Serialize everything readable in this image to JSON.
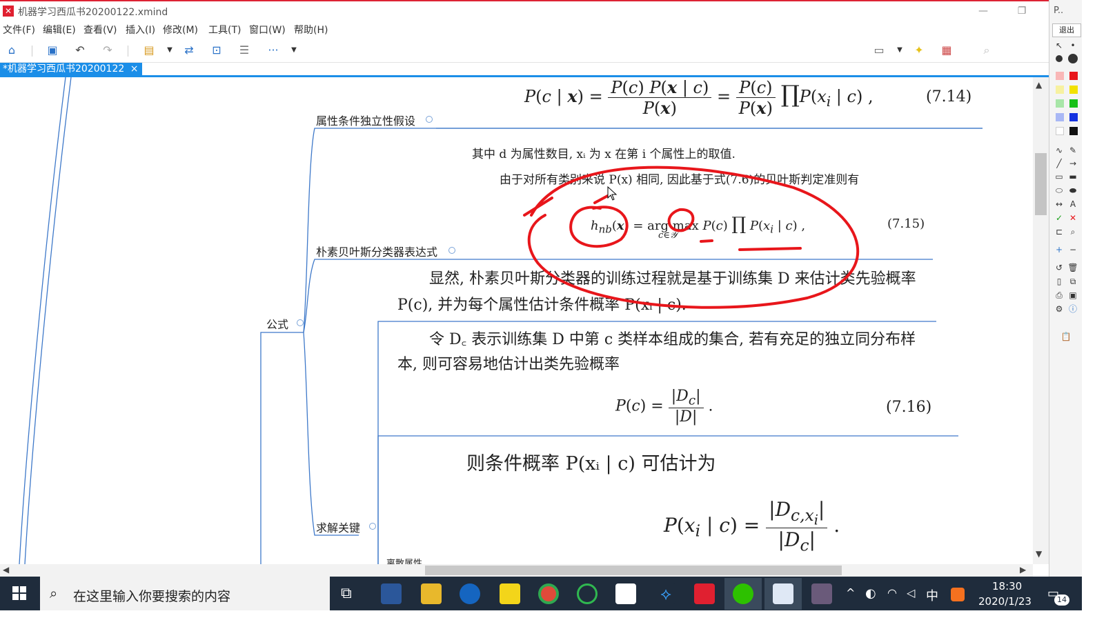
{
  "window": {
    "title": "机器学习西瓜书20200122.xmind",
    "logo_glyph": "✕"
  },
  "menu": [
    "文件(F)",
    "编辑(E)",
    "查看(V)",
    "插入(I)",
    "修改(M)",
    "工具(T)",
    "窗口(W)",
    "帮助(H)"
  ],
  "tab": {
    "label": "*机器学习西瓜书20200122",
    "close": "×"
  },
  "topics": {
    "t1": "属性条件独立性假设",
    "t2": "朴素贝叶斯分类器表达式",
    "t3": "公式",
    "t4": "求解关键",
    "t5": "离散属性"
  },
  "math": {
    "eq714_num": "(7.14)",
    "eq715_num": "(7.15)",
    "eq716_num": "(7.16)",
    "line1": "其中 d 为属性数目, xᵢ 为 x 在第 i 个属性上的取值.",
    "line2": "由于对所有类别来说 P(x) 相同, 因此基于式(7.6)的贝叶斯判定准则有",
    "para1a": "显然, 朴素贝叶斯分类器的训练过程就是基于训练集 D 来估计类先验概率",
    "para1b": "P(c), 并为每个属性估计条件概率 P(xᵢ | c).",
    "para2a": "令 D꜀ 表示训练集 D 中第 c 类样本组成的集合, 若有充足的独立同分布样",
    "para2b": "本, 则可容易地估计出类先验概率",
    "para3": "则条件概率 P(xᵢ | c) 可估计为"
  },
  "rightpanel": {
    "top_label": "P..",
    "exit": "退出"
  },
  "taskbar": {
    "search_placeholder": "在这里输入你要搜索的内容",
    "time": "18:30",
    "date": "2020/1/23",
    "ime": "中",
    "notif": "14"
  },
  "colors": {
    "accent": "#1b8ee8",
    "annotation": "#e8161b",
    "taskbar": "#1f2c3c",
    "topic_line": "#3d78c9"
  }
}
